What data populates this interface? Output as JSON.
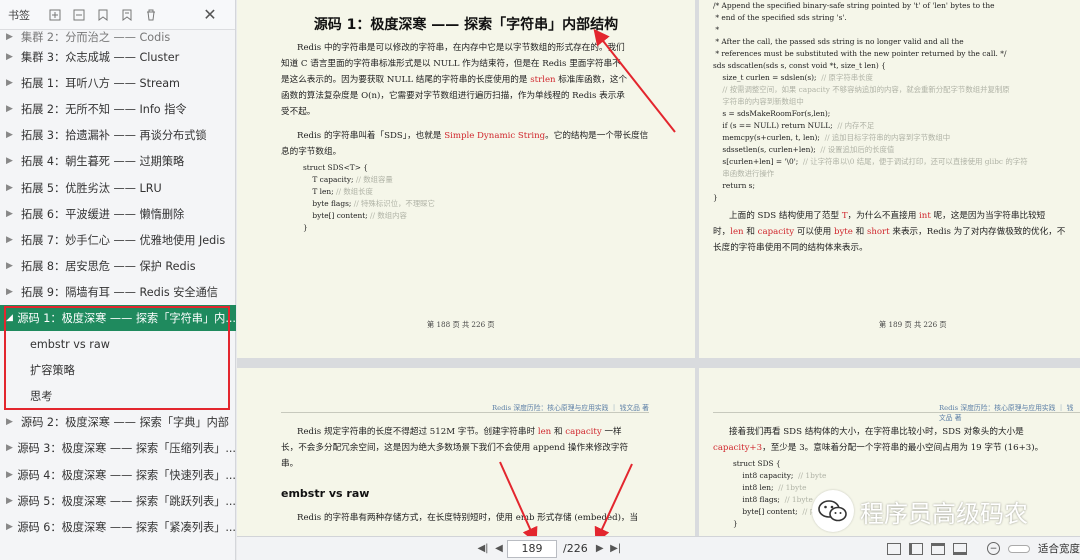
{
  "sidebar": {
    "title": "书签",
    "items_top": [
      {
        "label": "集群 2：分而治之 —— Codis"
      },
      {
        "label": "集群 3：众志成城 —— Cluster"
      },
      {
        "label": "拓展 1：耳听八方 —— Stream"
      },
      {
        "label": "拓展 2：无所不知 —— Info 指令"
      },
      {
        "label": "拓展 3：拾遗漏补 —— 再谈分布式锁"
      },
      {
        "label": "拓展 4：朝生暮死 —— 过期策略"
      },
      {
        "label": "拓展 5：优胜劣汰 —— LRU"
      },
      {
        "label": "拓展 6：平波缓进 —— 懒惰删除"
      },
      {
        "label": "拓展 7：妙手仁心 —— 优雅地使用 Jedis"
      },
      {
        "label": "拓展 8：居安思危 —— 保护 Redis"
      },
      {
        "label": "拓展 9：隔墙有耳 —— Redis 安全通信"
      }
    ],
    "active_item": {
      "label": "源码 1：极度深寒 —— 探索「字符串」内..."
    },
    "sub_items": [
      {
        "label": "embstr vs raw"
      },
      {
        "label": "扩容策略"
      },
      {
        "label": "思考"
      }
    ],
    "items_bottom": [
      {
        "label": "源码 2：极度深寒 —— 探索「字典」内部"
      },
      {
        "label": "源码 3：极度深寒 —— 探索「压缩列表」..."
      },
      {
        "label": "源码 4：极度深寒 —— 探索「快速列表」..."
      },
      {
        "label": "源码 5：极度深寒 —— 探索「跳跃列表」..."
      },
      {
        "label": "源码 6：极度深寒 —— 探索「紧凑列表」..."
      }
    ]
  },
  "doc": {
    "p1": {
      "title": "源码 1：极度深寒 —— 探索「字符串」内部结构",
      "para1_a": "Redis 中的字符串是可以修改的字符串，在内存中它是以字节数组的形式存在的。我们",
      "para1_b": "知道 C 语言里面的字符串标准形式是以 NULL 作为结束符，但是在 Redis 里面字符串不",
      "para1_c": "是这么表示的。因为要获取 NULL 结尾的字符串的长度使用的是",
      "para1_c_red": "strlen",
      "para1_c2": "标准库函数，这个",
      "para1_d": "函数的算法复杂度是 O(n)，它需要对字节数组进行遍历扫描，作为单线程的 Redis 表示承",
      "para1_e": "受不起。",
      "para2_a": "Redis 的字符串叫着「SDS」，也就是",
      "para2_a_red": "Simple Dynamic String",
      "para2_a2": "。它的结构是一个带长度信",
      "para2_b": "息的字节数组。",
      "code": [
        {
          "t": "struct SDS<T> {",
          "c": ""
        },
        {
          "t": "    T capacity; ",
          "c": "// 数组容量"
        },
        {
          "t": "    T len; ",
          "c": "// 数组长度"
        },
        {
          "t": "    byte flags; ",
          "c": "// 特殊标识位，不理睬它"
        },
        {
          "t": "    byte[] content; ",
          "c": "// 数组内容"
        },
        {
          "t": "}",
          "c": ""
        }
      ],
      "footer": "第 188 页 共 226 页"
    },
    "p2": {
      "code": [
        {
          "t": "/* Append the specified binary-safe string pointed by 't' of 'len' bytes to the",
          "c": ""
        },
        {
          "t": " * end of the specified sds string 's'.",
          "c": ""
        },
        {
          "t": " *",
          "c": ""
        },
        {
          "t": " * After the call, the passed sds string is no longer valid and all the",
          "c": ""
        },
        {
          "t": " * references must be substituted with the new pointer returned by the call. */",
          "c": ""
        },
        {
          "t": "sds sdscatlen(sds s, const void *t, size_t len) {",
          "c": ""
        },
        {
          "t": "    size_t curlen = sdslen(s);  ",
          "c": "// 原字符串长度"
        },
        {
          "t": "    ",
          "c": "// 按需调整空间，如果 capacity 不够容纳追加的内容，就会重新分配字节数组并复制原"
        },
        {
          "t": "    ",
          "c": "字符串的内容到新数组中"
        },
        {
          "t": "    s = sdsMakeRoomFor(s,len);",
          "c": ""
        },
        {
          "t": "    if (s == NULL) return NULL;  ",
          "c": "// 内存不足"
        },
        {
          "t": "    memcpy(s+curlen, t, len);  ",
          "c": "// 追加目标字符串的内容到字节数组中"
        },
        {
          "t": "    sdssetlen(s, curlen+len);  ",
          "c": "// 设置追加后的长度值"
        },
        {
          "t": "    s[curlen+len] = '\\0';  ",
          "c": "// 让字符串以\\0 结尾，便于调试打印，还可以直接使用 glibc 的字符"
        },
        {
          "t": "    ",
          "c": "串函数进行操作"
        },
        {
          "t": "    return s;",
          "c": ""
        },
        {
          "t": "}",
          "c": ""
        }
      ],
      "para_a1": "上面的 SDS 结构使用了范型",
      "para_a_red1": "T",
      "para_a2": "，为什么不直接用",
      "para_a_red2": "int",
      "para_a3": "呢，这是因为当字符串比较短",
      "para_b1": "时，",
      "para_b_red1": "len",
      "para_b2": "和",
      "para_b_red2": "capacity",
      "para_b3": "可以使用",
      "para_b_red3": "byte",
      "para_b4": "和",
      "para_b_red4": "short",
      "para_b5": "来表示，Redis 为了对内存做极致的优化，不",
      "para_c": "长度的字符串使用不同的结构体来表示。",
      "footer": "第 189 页 共 226 页"
    },
    "p3": {
      "header": "Redis 深度历险：核心原理与应用实践 ｜ 钱文品 著",
      "para_a1": "Redis 规定字符串的长度不得超过 512M 字节。创建字符串时",
      "para_a_red1": "len",
      "para_a2": "和",
      "para_a_red2": "capacity",
      "para_a3": "一样",
      "para_b": "长，不会多分配冗余空间，这是因为绝大多数场景下我们不会使用 append 操作来修改字符",
      "para_c": "串。",
      "h2": "embstr vs raw",
      "para_d": "Redis 的字符串有两种存储方式，在长度特别短时，使用 emb 形式存储 (embeded)，当"
    },
    "p4": {
      "header": "Redis 深度历险：核心原理与应用实践 ｜ 钱文品 著",
      "para_a": "接着我们再看 SDS 结构体的大小，在字符串比较小时，SDS 对象头的大小是",
      "para_b_red": "capacity+3",
      "para_b": "，至少是 3。意味着分配一个字符串的最小空间占用为 19 字节 (16+3)。",
      "code": [
        {
          "t": "struct SDS {",
          "c": ""
        },
        {
          "t": "    int8 capacity;  ",
          "c": "// 1byte"
        },
        {
          "t": "    int8 len;  ",
          "c": "// 1byte"
        },
        {
          "t": "    int8 flags;  ",
          "c": "// 1byte"
        },
        {
          "t": "    byte[] content;  ",
          "c": "// 内联数组"
        },
        {
          "t": "}",
          "c": ""
        }
      ]
    }
  },
  "watermark": {
    "text": "程序员高级码农"
  },
  "bottombar": {
    "current_page": "189",
    "total_pages": "/226",
    "zoom_label": "适合宽度"
  },
  "colors": {
    "active": "#1f8a5e",
    "annotation": "#e3262e",
    "page_bg": "#f5f6e9"
  }
}
